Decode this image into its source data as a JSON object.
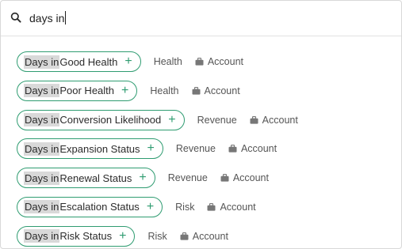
{
  "search": {
    "value": "days in",
    "icon": "search-icon"
  },
  "colors": {
    "accent": "#2f9c71",
    "highlight": "#d9d9d9"
  },
  "results": [
    {
      "match": "Days in",
      "rest": " Good Health",
      "category": "Health",
      "object": "Account"
    },
    {
      "match": "Days in",
      "rest": " Poor Health",
      "category": "Health",
      "object": "Account"
    },
    {
      "match": "Days in",
      "rest": " Conversion Likelihood",
      "category": "Revenue",
      "object": "Account"
    },
    {
      "match": "Days in",
      "rest": " Expansion Status",
      "category": "Revenue",
      "object": "Account"
    },
    {
      "match": "Days in",
      "rest": " Renewal Status",
      "category": "Revenue",
      "object": "Account"
    },
    {
      "match": "Days in",
      "rest": " Escalation Status",
      "category": "Risk",
      "object": "Account"
    },
    {
      "match": "Days in",
      "rest": " Risk Status",
      "category": "Risk",
      "object": "Account"
    }
  ],
  "add_symbol": "+"
}
